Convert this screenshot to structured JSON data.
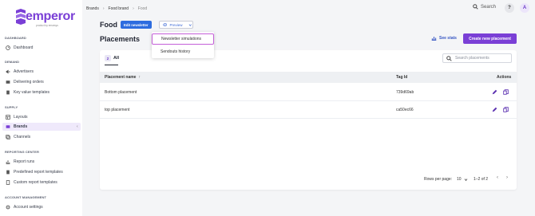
{
  "app": {
    "logo_text": "emperor",
    "logo_sub": "product by emarsys",
    "colors": {
      "accent": "#7a3fd6",
      "primary_button": "#2d6cdf"
    }
  },
  "sidebar": {
    "sections": [
      {
        "title": "DASHBOARD",
        "items": [
          {
            "label": "Dashboard",
            "icon": "dashboard-icon"
          }
        ]
      },
      {
        "title": "DEMAND",
        "items": [
          {
            "label": "Advertisers",
            "icon": "megaphone-icon"
          },
          {
            "label": "Delivering orders",
            "icon": "order-icon"
          },
          {
            "label": "Key value templates",
            "icon": "template-icon"
          }
        ]
      },
      {
        "title": "SUPPLY",
        "items": [
          {
            "label": "Layouts",
            "icon": "layout-icon"
          },
          {
            "label": "Brands",
            "icon": "brand-icon",
            "active": true
          },
          {
            "label": "Channels",
            "icon": "channel-icon"
          }
        ]
      },
      {
        "title": "REPORTING CENTER",
        "items": [
          {
            "label": "Report runs",
            "icon": "chart-icon"
          },
          {
            "label": "Predefined report templates",
            "icon": "report-template-icon"
          },
          {
            "label": "Custom report templates",
            "icon": "custom-report-icon"
          }
        ]
      },
      {
        "title": "ACCOUNT MANAGEMENT",
        "items": [
          {
            "label": "Account settings",
            "icon": "settings-icon"
          }
        ]
      }
    ],
    "collapse_glyph": "‹"
  },
  "topbar": {
    "breadcrumb": [
      "Brands",
      "Food brand",
      "Food"
    ],
    "breadcrumb_sep": "›",
    "search_label": "Search",
    "help_label": "?",
    "avatar_initial": "A"
  },
  "brand": {
    "title": "Food",
    "edit_newsletter_label": "Edit newsletter",
    "preview_label": "Preview"
  },
  "dropdown": {
    "items": [
      "Newsletter simulations",
      "Sendouts history"
    ]
  },
  "placements": {
    "title": "Placements",
    "see_stats_label": "See stats",
    "create_label": "Create new placement",
    "tab": {
      "count": "2",
      "label": "All"
    },
    "search_placeholder": "Search placements",
    "columns": {
      "name": "Placement name",
      "sort_glyph": "↑",
      "tag": "Tag Id",
      "actions": "Actions"
    },
    "rows": [
      {
        "name": "Bottom placement",
        "tag": "739d69ab"
      },
      {
        "name": "top placement",
        "tag": "ca50ec66"
      }
    ],
    "pagination": {
      "rows_label": "Rows per page:",
      "rows_value": "10",
      "range": "1–2 of 2"
    }
  }
}
